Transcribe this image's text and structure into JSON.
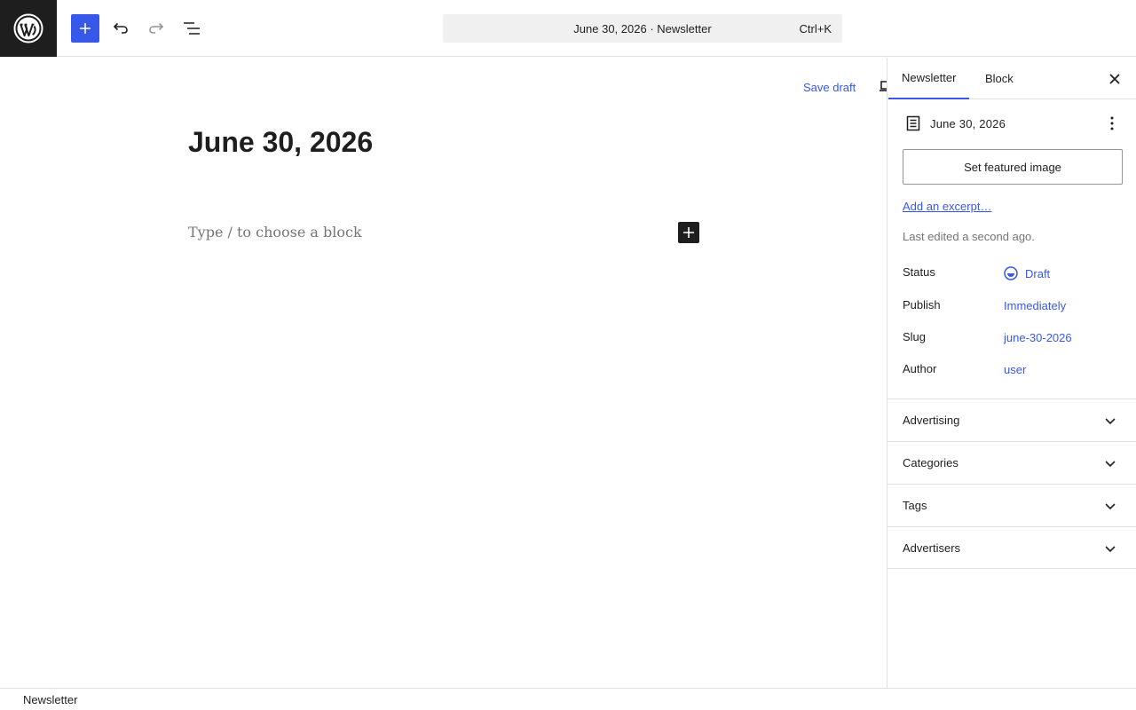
{
  "topbar": {
    "logo_icon": "wordpress-logo-icon",
    "add_icon": "plus-icon",
    "undo_icon": "undo-icon",
    "redo_icon": "redo-icon",
    "list_view_icon": "list-view-icon",
    "command": {
      "title": "June 30, 2026",
      "separator": " · ",
      "post_type": "Newsletter",
      "shortcut": "Ctrl+K"
    }
  },
  "canvas": {
    "save_draft_label": "Save draft",
    "preview_icon": "desktop-preview-icon",
    "post_title": "June 30, 2026",
    "block_placeholder": "Type / to choose a block",
    "inserter_icon": "plus-icon"
  },
  "sidebar": {
    "tabs": [
      {
        "label": "Newsletter",
        "active": true
      },
      {
        "label": "Block",
        "active": false
      }
    ],
    "close_icon": "close-icon",
    "document": {
      "icon": "post-document-icon",
      "title": "June 30, 2026",
      "menu_icon": "more-vertical-icon"
    },
    "featured_image_label": "Set featured image",
    "excerpt_link": "Add an excerpt…",
    "last_edited": "Last edited a second ago.",
    "meta": [
      {
        "label": "Status",
        "value": "Draft",
        "icon": "draft-status-icon"
      },
      {
        "label": "Publish",
        "value": "Immediately"
      },
      {
        "label": "Slug",
        "value": "june-30-2026"
      },
      {
        "label": "Author",
        "value": "user"
      }
    ],
    "panels": [
      {
        "label": "Advertising",
        "icon": "chevron-down-icon"
      },
      {
        "label": "Categories",
        "icon": "chevron-down-icon"
      },
      {
        "label": "Tags",
        "icon": "chevron-down-icon"
      },
      {
        "label": "Advertisers",
        "icon": "chevron-down-icon"
      }
    ]
  },
  "footer": {
    "breadcrumb": "Newsletter"
  },
  "colors": {
    "accent": "#3858e9",
    "dark": "#1e1e1e",
    "muted": "#757575",
    "border": "#e0e0e0"
  }
}
